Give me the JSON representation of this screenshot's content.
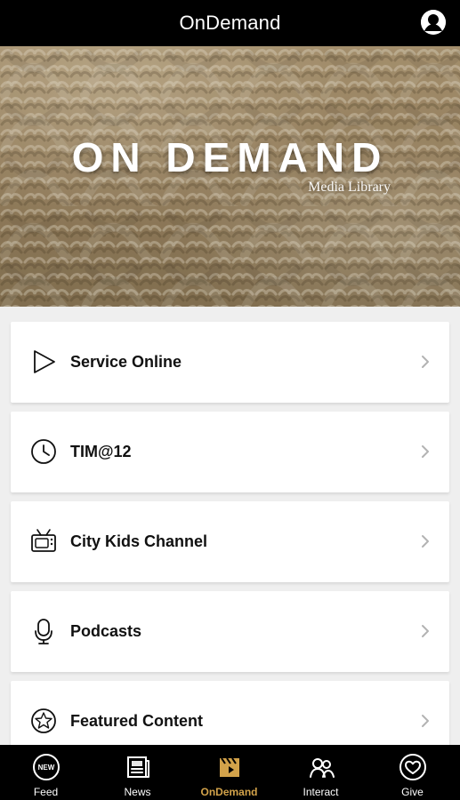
{
  "header": {
    "title": "OnDemand"
  },
  "hero": {
    "title": "ON DEMAND",
    "subtitle": "Media Library"
  },
  "items": [
    {
      "label": "Service Online",
      "icon": "play-icon"
    },
    {
      "label": "TIM@12",
      "icon": "clock-icon"
    },
    {
      "label": "City Kids Channel",
      "icon": "tv-icon"
    },
    {
      "label": "Podcasts",
      "icon": "microphone-icon"
    },
    {
      "label": "Featured Content",
      "icon": "star-icon"
    }
  ],
  "tabbar": {
    "tabs": [
      {
        "label": "Feed",
        "icon": "new-badge-icon"
      },
      {
        "label": "News",
        "icon": "newspaper-icon"
      },
      {
        "label": "OnDemand",
        "icon": "clapperboard-icon",
        "active": true
      },
      {
        "label": "Interact",
        "icon": "people-icon"
      },
      {
        "label": "Give",
        "icon": "heart-icon"
      }
    ],
    "active_color": "#d2a24a"
  },
  "colors": {
    "header_bg": "#000000",
    "tabbar_bg": "#000000",
    "list_bg": "#efefef",
    "card_bg": "#ffffff"
  }
}
